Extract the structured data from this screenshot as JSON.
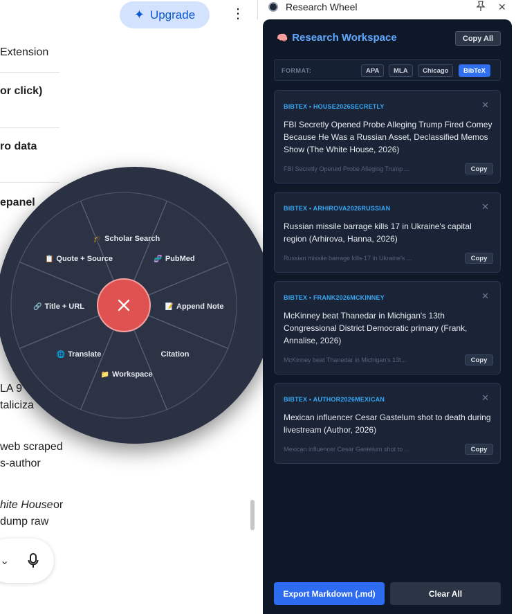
{
  "chat": {
    "upgrade_label": "Upgrade",
    "kebab": "⋮",
    "lines": [
      {
        "text": "Extension",
        "bold": false
      },
      {
        "text": "or click)",
        "bold": true
      },
      {
        "text": "ro data",
        "bold": true
      },
      {
        "text": "epanel",
        "bold": true
      },
      {
        "text": "LA 9",
        "bold": false
      },
      {
        "text": "taliciza",
        "bold": false
      },
      {
        "text": " web scraped",
        "bold": false
      },
      {
        "text": "s-author",
        "bold": false
      },
      {
        "text": "hite House",
        "bold": false,
        "italic": true
      },
      {
        "text": "or",
        "bold": false
      },
      {
        "text": " dump raw",
        "bold": false
      }
    ]
  },
  "wheel": {
    "items": [
      {
        "icon": "🎓",
        "label": "Scholar Search"
      },
      {
        "icon": "🧬",
        "label": "PubMed"
      },
      {
        "icon": "📝",
        "label": "Append Note"
      },
      {
        "icon": "",
        "label": "Citation"
      },
      {
        "icon": "📁",
        "label": "Workspace"
      },
      {
        "icon": "🌐",
        "label": "Translate"
      },
      {
        "icon": "🔗",
        "label": "Title + URL"
      },
      {
        "icon": "📋",
        "label": "Quote + Source"
      }
    ],
    "close_label": "✕"
  },
  "side_header": {
    "title": "Research Wheel"
  },
  "workspace": {
    "icon": "🧠",
    "title": "Research Workspace",
    "copy_all_label": "Copy All",
    "format_label": "FORMAT:",
    "formats": [
      {
        "label": "APA",
        "active": false
      },
      {
        "label": "MLA",
        "active": false
      },
      {
        "label": "Chicago",
        "active": false
      },
      {
        "label": "BibTeX",
        "active": true
      }
    ],
    "cards": [
      {
        "key": "BIBTEX • HOUSE2026SECRETLY",
        "text": "FBI Secretly Opened Probe Alleging Trump Fired Comey Because He Was a Russian Asset, Declassified Memos Show (The White House, 2026)",
        "preview": "FBI Secretly Opened Probe Alleging Trump ...",
        "copy_label": "Copy"
      },
      {
        "key": "BIBTEX • ARHIROVA2026RUSSIAN",
        "text": "Russian missile barrage kills 17 in Ukraine's capital region (Arhirova, Hanna, 2026)",
        "preview": "Russian missile barrage kills 17 in Ukraine's ...",
        "copy_label": "Copy"
      },
      {
        "key": "BIBTEX • FRANK2026MCKINNEY",
        "text": "McKinney beat Thanedar in Michigan's 13th Congressional District Democratic primary (Frank, Annalise, 2026)",
        "preview": "McKinney beat Thanedar in Michigan's 13t...",
        "copy_label": "Copy"
      },
      {
        "key": "BIBTEX • AUTHOR2026MEXICAN",
        "text": "Mexican influencer Cesar Gastelum shot to death during livestream (Author, 2026)",
        "preview": "Mexican influencer Cesar Gastelum shot to ...",
        "copy_label": "Copy"
      }
    ],
    "export_label": "Export Markdown (.md)",
    "clear_label": "Clear All"
  }
}
